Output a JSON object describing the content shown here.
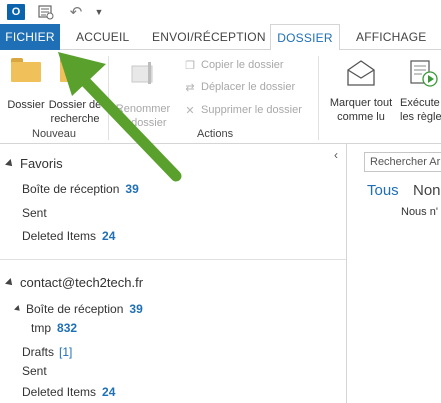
{
  "qat": {
    "app_icon_letter": "O",
    "icons": [
      "outlook-app-icon",
      "send-receive-icon",
      "undo-icon",
      "qat-dropdown-icon"
    ]
  },
  "tabs": {
    "fichier": "FICHIER",
    "accueil": "ACCUEIL",
    "envoi": "ENVOI/RÉCEPTION",
    "dossier": "DOSSIER",
    "affichage": "AFFICHAGE",
    "active": "DOSSIER"
  },
  "ribbon": {
    "nouveau": {
      "dossier_label": "Dossier",
      "dossier_recherche_line1": "Dossier de",
      "dossier_recherche_line2": "recherche",
      "group_label": "Nouveau"
    },
    "actions": {
      "renommer_line1": "Renommer",
      "renommer_line2": "le dossier",
      "copier": "Copier le dossier",
      "deplacer": "Déplacer le dossier",
      "supprimer": "Supprimer le dossier",
      "group_label": "Actions"
    },
    "marquer_line1": "Marquer tout",
    "marquer_line2": "comme lu",
    "executer_line1": "Exécute",
    "executer_line2": "les règle"
  },
  "folder_pane": {
    "favorites": {
      "header": "Favoris",
      "items": [
        {
          "label": "Boîte de réception",
          "count": "39"
        },
        {
          "label": "Sent",
          "count": ""
        },
        {
          "label": "Deleted Items",
          "count": "24"
        }
      ]
    },
    "account": {
      "header": "contact@tech2tech.fr",
      "inbox": {
        "label": "Boîte de réception",
        "count": "39"
      },
      "tmp": {
        "label": "tmp",
        "count": "832"
      },
      "drafts": {
        "label": "Drafts",
        "count": "[1]"
      },
      "sent": {
        "label": "Sent"
      },
      "deleted": {
        "label": "Deleted Items",
        "count": "24"
      }
    }
  },
  "message_list": {
    "search_placeholder": "Rechercher Ar",
    "filter_all": "Tous",
    "filter_unread": "Non",
    "empty_text": "Nous n'"
  },
  "colors": {
    "accent": "#1f6fb6",
    "arrow": "#5aa02c",
    "folder": "#f0c05a"
  }
}
